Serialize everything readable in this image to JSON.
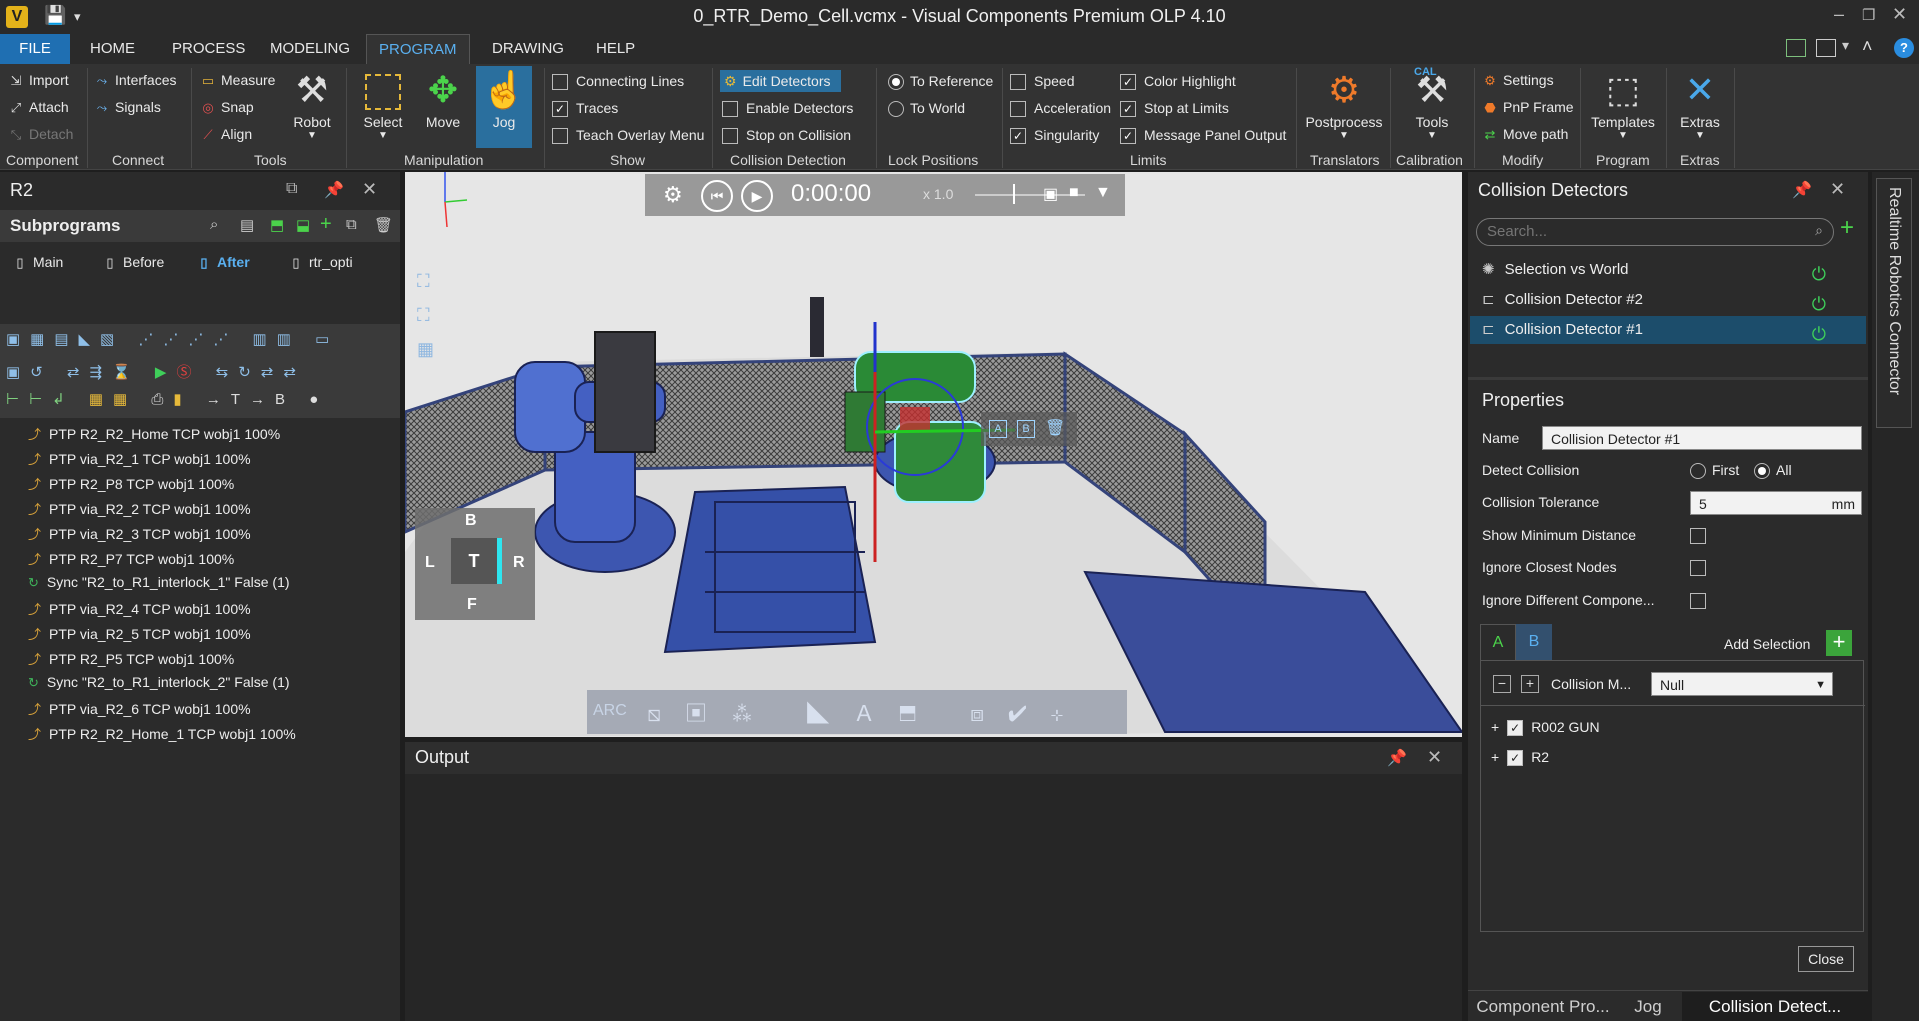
{
  "app": {
    "title": "0_RTR_Demo_Cell.vcmx - Visual Components Premium OLP 4.10",
    "logo_text": "V"
  },
  "menu": {
    "file": "FILE",
    "tabs": [
      "HOME",
      "PROCESS",
      "MODELING",
      "PROGRAM",
      "DRAWING",
      "HELP"
    ],
    "active": "PROGRAM"
  },
  "ribbon": {
    "component": {
      "import": "Import",
      "attach": "Attach",
      "detach": "Detach",
      "group": "Component"
    },
    "connect": {
      "interfaces": "Interfaces",
      "signals": "Signals",
      "group": "Connect"
    },
    "tools": {
      "measure": "Measure",
      "snap": "Snap",
      "align": "Align",
      "robot": "Robot",
      "group": "Tools"
    },
    "manipulation": {
      "select": "Select",
      "move": "Move",
      "jog": "Jog",
      "group": "Manipulation"
    },
    "show": {
      "connecting_lines": "Connecting Lines",
      "traces": "Traces",
      "teach_overlay": "Teach Overlay Menu",
      "group": "Show"
    },
    "collision": {
      "edit_detectors": "Edit Detectors",
      "enable_detectors": "Enable Detectors",
      "stop_on_collision": "Stop on Collision",
      "group": "Collision Detection"
    },
    "lock": {
      "to_reference": "To Reference",
      "to_world": "To World",
      "group": "Lock Positions"
    },
    "limits": {
      "speed": "Speed",
      "acceleration": "Acceleration",
      "singularity": "Singularity",
      "color_highlight": "Color Highlight",
      "stop_at_limits": "Stop at Limits",
      "message_panel": "Message Panel Output",
      "group": "Limits"
    },
    "translators": {
      "postprocess": "Postprocess",
      "group": "Translators"
    },
    "calibration": {
      "tools": "Tools",
      "cal": "CAL",
      "group": "Calibration"
    },
    "modify": {
      "settings": "Settings",
      "pnp_frame": "PnP Frame",
      "move_path": "Move path",
      "group": "Modify"
    },
    "program": {
      "templates": "Templates",
      "group": "Program"
    },
    "extras": {
      "extras": "Extras",
      "group": "Extras"
    }
  },
  "left_panel": {
    "title": "R2",
    "subprograms_label": "Subprograms",
    "routines": [
      "Main",
      "Before",
      "After",
      "rtr_opti"
    ],
    "active_routine": "After",
    "statements": [
      {
        "type": "ptp",
        "text": "PTP R2_R2_Home TCP wobj1 100%"
      },
      {
        "type": "ptp",
        "text": "PTP via_R2_1 TCP wobj1 100%"
      },
      {
        "type": "ptp",
        "text": "PTP R2_P8 TCP wobj1 100%"
      },
      {
        "type": "ptp",
        "text": "PTP via_R2_2 TCP wobj1 100%"
      },
      {
        "type": "ptp",
        "text": "PTP via_R2_3 TCP wobj1 100%"
      },
      {
        "type": "ptp",
        "text": "PTP R2_P7 TCP wobj1 100%"
      },
      {
        "type": "sync",
        "text": "Sync \"R2_to_R1_interlock_1\" False (1)"
      },
      {
        "type": "ptp",
        "text": "PTP via_R2_4 TCP wobj1 100%"
      },
      {
        "type": "ptp",
        "text": "PTP via_R2_5 TCP wobj1 100%"
      },
      {
        "type": "ptp",
        "text": "PTP R2_P5 TCP wobj1 100%"
      },
      {
        "type": "sync",
        "text": "Sync \"R2_to_R1_interlock_2\" False (1)"
      },
      {
        "type": "ptp",
        "text": "PTP via_R2_6 TCP wobj1 100%"
      },
      {
        "type": "ptp",
        "text": "PTP R2_R2_Home_1 TCP wobj1 100%"
      }
    ]
  },
  "viewport": {
    "time": "0:00:00",
    "speed": "x 1.0",
    "navcube": {
      "top": "B",
      "left": "L",
      "center": "T",
      "right": "R",
      "bottom": "F"
    },
    "gizmo_buttons": [
      "A",
      "B"
    ],
    "toolbar_label": "ARC"
  },
  "output": {
    "title": "Output"
  },
  "right_panel": {
    "title": "Collision Detectors",
    "search_placeholder": "Search...",
    "detectors": [
      "Selection vs World",
      "Collision Detector #2",
      "Collision Detector #1"
    ],
    "selected": "Collision Detector #1",
    "properties_title": "Properties",
    "name_label": "Name",
    "name_value": "Collision Detector #1",
    "detect_label": "Detect Collision",
    "detect_first": "First",
    "detect_all": "All",
    "tolerance_label": "Collision Tolerance",
    "tolerance_value": "5",
    "tolerance_unit": "mm",
    "show_min_distance": "Show Minimum Distance",
    "ignore_closest": "Ignore Closest Nodes",
    "ignore_different": "Ignore Different Compone...",
    "tab_a": "A",
    "tab_b": "B",
    "add_selection": "Add Selection",
    "collision_mode_label": "Collision M...",
    "collision_mode_value": "Null",
    "tree_items": [
      "R002 GUN",
      "R2"
    ],
    "close_button": "Close",
    "bottom_tabs": [
      "Component Pro...",
      "Jog",
      "Collision Detect..."
    ],
    "side_tab": "Realtime Robotics Connector"
  }
}
